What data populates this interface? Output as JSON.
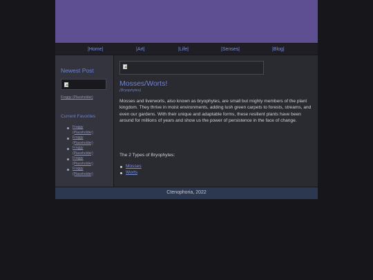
{
  "nav": {
    "home": "|Home|",
    "art": "|Art|",
    "life": "|Life|",
    "senses": "|Senses|",
    "blog": "|Blog|"
  },
  "sidebar": {
    "newest_heading": "Newest Post",
    "newest_link": "Froggy (Placeholder)",
    "favorites_heading": "Current Favorites",
    "favorites": [
      "Froggy (Placeholder)",
      "Froggy (Placeholder)",
      "Froggy (Placeholder)",
      "Froggy (Placeholder)",
      "Froggy (Placeholder)"
    ]
  },
  "main": {
    "title": "Mosses/Worts!",
    "subtitle": "(Bryophytes)",
    "body": "Mosses and liverworts, also known as bryophytes, are small but mighty members of the plant kingdom. They thrive in moist environments, adding lush green carpets to forests, streams, and even our gardens. With their unique and adaptable forms, these resilient plants have been around for millions of years and show us the power of persistence in the face of change.",
    "types_heading": "The 2 Types of Bryophytes:",
    "types": [
      "Mosses",
      "Worts"
    ]
  },
  "footer": {
    "text": "Ctenophoria, 2022"
  },
  "colors": {
    "banner": "#5e4f93",
    "accent": "#7184d2",
    "background": "#17161b",
    "footer": "#2c3850"
  }
}
